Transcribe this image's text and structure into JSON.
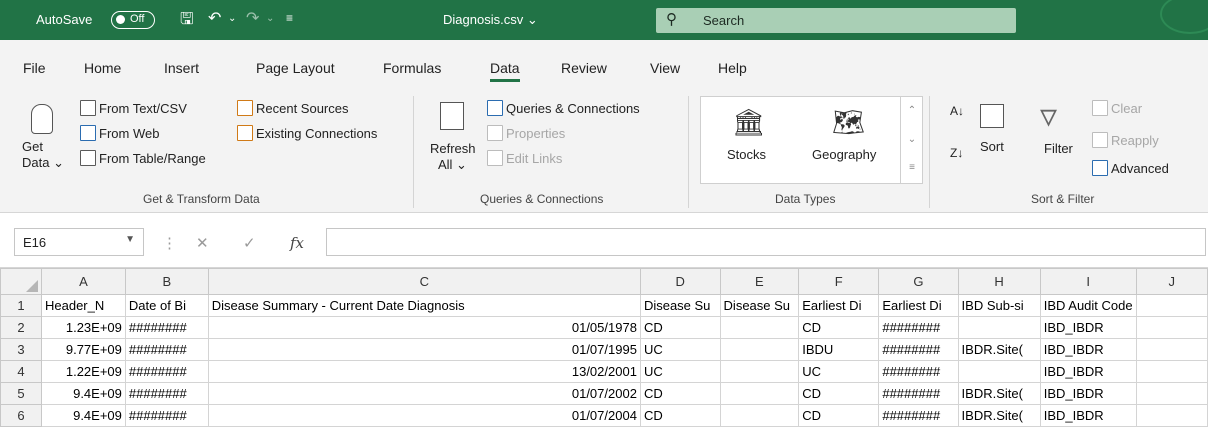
{
  "titlebar": {
    "autosave_label": "AutoSave",
    "autosave_state": "Off",
    "filename": "Diagnosis.csv",
    "filename_caret": "⌄",
    "search_placeholder": "Search",
    "accent": "#217346"
  },
  "tabs": [
    "File",
    "Home",
    "Insert",
    "Page Layout",
    "Formulas",
    "Data",
    "Review",
    "View",
    "Help"
  ],
  "active_tab": "Data",
  "ribbon": {
    "get_transform": {
      "get_data": "Get",
      "get_data_2": "Data ⌄",
      "from_text": "From Text/CSV",
      "from_web": "From Web",
      "from_table": "From Table/Range",
      "recent_sources": "Recent Sources",
      "existing_connections": "Existing Connections",
      "label": "Get & Transform Data"
    },
    "queries": {
      "refresh": "Refresh",
      "refresh_2": "All ⌄",
      "queries_connections": "Queries & Connections",
      "properties": "Properties",
      "edit_links": "Edit Links",
      "label": "Queries & Connections"
    },
    "data_types": {
      "stocks": "Stocks",
      "geography": "Geography",
      "label": "Data Types"
    },
    "sort_filter": {
      "sort": "Sort",
      "filter": "Filter",
      "clear": "Clear",
      "reapply": "Reapply",
      "advanced": "Advanced",
      "label": "Sort & Filter"
    }
  },
  "formula_bar": {
    "name_box": "E16",
    "fx": "fx",
    "content": ""
  },
  "grid": {
    "columns": [
      "A",
      "B",
      "C",
      "D",
      "E",
      "F",
      "G",
      "H",
      "I",
      "J"
    ],
    "rows": [
      {
        "n": "1",
        "cells": [
          "Header_N",
          "Date of Bi",
          "Disease Summary - Current Date Diagnosis",
          "Disease Su",
          "Disease Su",
          "Earliest Di",
          "Earliest Di",
          "IBD Sub-si",
          "IBD Audit Code",
          ""
        ]
      },
      {
        "n": "2",
        "cells": [
          "1.23E+09",
          "########",
          "01/05/1978",
          "CD",
          "",
          "CD",
          "########",
          "",
          "IBD_IBDR",
          ""
        ]
      },
      {
        "n": "3",
        "cells": [
          "9.77E+09",
          "########",
          "01/07/1995",
          "UC",
          "",
          "IBDU",
          "########",
          "IBDR.Site(",
          "IBD_IBDR",
          ""
        ]
      },
      {
        "n": "4",
        "cells": [
          "1.22E+09",
          "########",
          "13/02/2001",
          "UC",
          "",
          "UC",
          "########",
          "",
          "IBD_IBDR",
          ""
        ]
      },
      {
        "n": "5",
        "cells": [
          "9.4E+09",
          "########",
          "01/07/2002",
          "CD",
          "",
          "CD",
          "########",
          "IBDR.Site(",
          "IBD_IBDR",
          ""
        ]
      },
      {
        "n": "6",
        "cells": [
          "9.4E+09",
          "########",
          "01/07/2004",
          "CD",
          "",
          "CD",
          "########",
          "IBDR.Site(",
          "IBD_IBDR",
          ""
        ]
      }
    ]
  }
}
